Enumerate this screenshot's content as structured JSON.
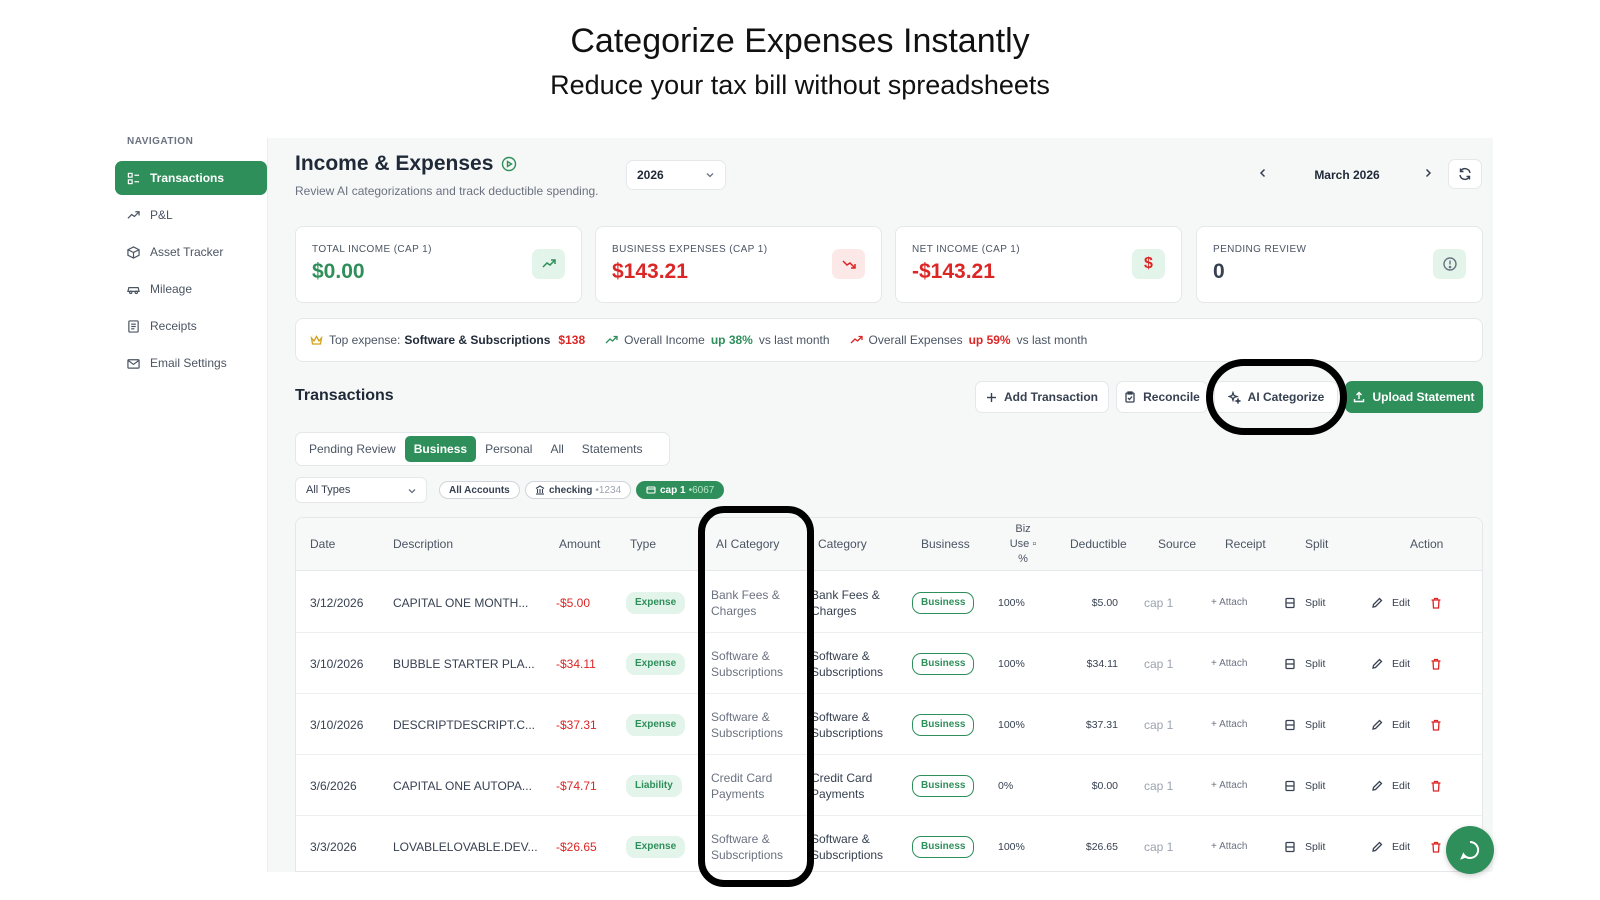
{
  "hero": {
    "title": "Categorize Expenses Instantly",
    "subtitle": "Reduce your tax bill without spreadsheets"
  },
  "sidebar": {
    "heading": "NAVIGATION",
    "items": [
      {
        "label": "Transactions",
        "icon": "list-icon",
        "active": true
      },
      {
        "label": "P&L",
        "icon": "trend-icon"
      },
      {
        "label": "Asset Tracker",
        "icon": "box-icon"
      },
      {
        "label": "Mileage",
        "icon": "car-icon"
      },
      {
        "label": "Receipts",
        "icon": "receipt-icon"
      },
      {
        "label": "Email Settings",
        "icon": "mail-icon"
      }
    ]
  },
  "header": {
    "title": "Income & Expenses",
    "description": "Review AI categorizations and track deductible spending.",
    "year": "2026",
    "month": "March 2026"
  },
  "stats": [
    {
      "label": "TOTAL INCOME (CAP 1)",
      "value": "$0.00",
      "tone": "green",
      "icon": "trend-up-icon",
      "icon_bg": "#e3f4ea"
    },
    {
      "label": "BUSINESS EXPENSES (CAP 1)",
      "value": "$143.21",
      "tone": "red",
      "icon": "trend-down-icon",
      "icon_bg": "#fde8e8"
    },
    {
      "label": "NET INCOME (CAP 1)",
      "value": "-$143.21",
      "tone": "red",
      "icon": "dollar-icon",
      "icon_bg": "#e3f4ea"
    },
    {
      "label": "PENDING REVIEW",
      "value": "0",
      "tone": "neutral",
      "icon": "alert-icon",
      "icon_bg": "#e3f4ea"
    }
  ],
  "insights": {
    "top_label": "Top expense:",
    "top_category": "Software & Subscriptions",
    "top_amount": "$138",
    "income_label": "Overall Income",
    "income_change": "up 38%",
    "income_suffix": "vs last month",
    "expense_label": "Overall Expenses",
    "expense_change": "up 59%",
    "expense_suffix": "vs last month"
  },
  "transactions": {
    "title": "Transactions",
    "buttons": {
      "add": "Add Transaction",
      "reconcile": "Reconcile",
      "ai": "AI Categorize",
      "upload": "Upload Statement"
    },
    "tabs": [
      "Pending Review",
      "Business",
      "Personal",
      "All",
      "Statements"
    ],
    "active_tab": "Business",
    "filters": {
      "type": "All Types",
      "accounts": "All Accounts",
      "checking": "checking",
      "checking_num": "•1234",
      "cap": "cap 1",
      "cap_num": "•6067"
    },
    "columns": {
      "date": "Date",
      "description": "Description",
      "amount": "Amount",
      "type": "Type",
      "ai_category": "AI Category",
      "category": "Category",
      "business": "Business",
      "biz_use": "Biz Use ▫ %",
      "deductible": "Deductible",
      "source": "Source",
      "receipt": "Receipt",
      "split": "Split",
      "action": "Action"
    },
    "rows": [
      {
        "date": "3/12/2026",
        "description": "CAPITAL ONE MONTH...",
        "amount": "-$5.00",
        "type": "Expense",
        "ai_category": "Bank Fees & Charges",
        "category": "Bank Fees & Charges",
        "business": "Business",
        "biz_use": "100%",
        "deductible": "$5.00",
        "source": "cap 1",
        "receipt": "+ Attach",
        "split": "Split",
        "edit": "Edit"
      },
      {
        "date": "3/10/2026",
        "description": "BUBBLE STARTER PLA...",
        "amount": "-$34.11",
        "type": "Expense",
        "ai_category": "Software & Subscriptions",
        "category": "Software & Subscriptions",
        "business": "Business",
        "biz_use": "100%",
        "deductible": "$34.11",
        "source": "cap 1",
        "receipt": "+ Attach",
        "split": "Split",
        "edit": "Edit"
      },
      {
        "date": "3/10/2026",
        "description": "DESCRIPTDESCRIPT.C...",
        "amount": "-$37.31",
        "type": "Expense",
        "ai_category": "Software & Subscriptions",
        "category": "Software & Subscriptions",
        "business": "Business",
        "biz_use": "100%",
        "deductible": "$37.31",
        "source": "cap 1",
        "receipt": "+ Attach",
        "split": "Split",
        "edit": "Edit"
      },
      {
        "date": "3/6/2026",
        "description": "CAPITAL ONE AUTOPA...",
        "amount": "-$74.71",
        "type": "Liability",
        "ai_category": "Credit Card Payments",
        "category": "Credit Card Payments",
        "business": "Business",
        "biz_use": "0%",
        "deductible": "$0.00",
        "source": "cap 1",
        "receipt": "+ Attach",
        "split": "Split",
        "edit": "Edit"
      },
      {
        "date": "3/3/2026",
        "description": "LOVABLELOVABLE.DEV...",
        "amount": "-$26.65",
        "type": "Expense",
        "ai_category": "Software & Subscriptions",
        "category": "Software & Subscriptions",
        "business": "Business",
        "biz_use": "100%",
        "deductible": "$26.65",
        "source": "cap 1",
        "receipt": "+ Attach",
        "split": "Split",
        "edit": "Edit"
      }
    ]
  },
  "colors": {
    "accent": "#2f8f5b",
    "negative": "#dc2626"
  }
}
